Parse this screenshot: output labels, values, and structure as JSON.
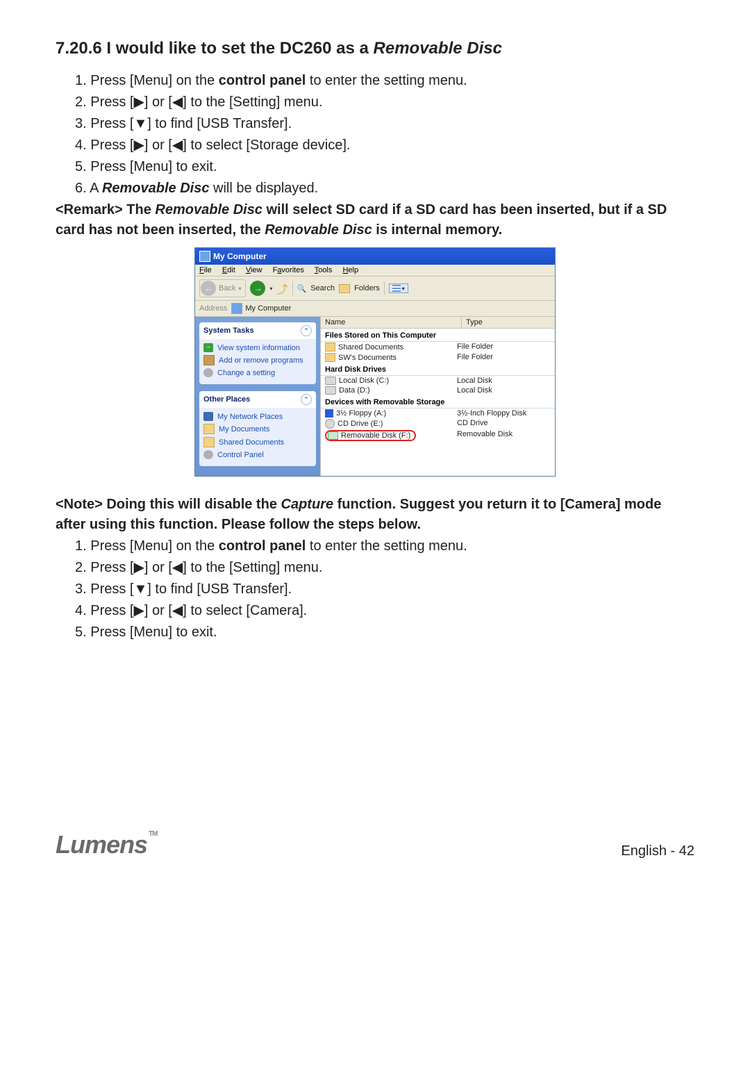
{
  "heading_num": "7.20.6",
  "heading_text_a": " I would like to set the DC260 as a ",
  "heading_text_italic": "Removable Disc",
  "steps1": {
    "s1a": "1. Press [Menu] on the ",
    "s1b": "control panel",
    "s1c": " to enter the setting menu.",
    "s2": "2. Press [▶] or [◀] to the [Setting] menu.",
    "s3": "3. Press [▼] to find [USB Transfer].",
    "s4": "4. Press [▶] or [◀] to select [Storage device].",
    "s5": "5. Press [Menu] to exit.",
    "s6a": "6. A ",
    "s6b": "Removable Disc",
    "s6c": " will be displayed."
  },
  "remark": {
    "a": "<Remark> The ",
    "b": "Removable Disc",
    "c": " will select SD card if a SD card has been inserted, but if a SD card has not been inserted, the ",
    "d": "Removable Disc",
    "e": " is internal memory."
  },
  "note": {
    "a": "<Note> Doing this will disable the ",
    "b": "Capture",
    "c": " function. Suggest you return it to [Camera] mode after using this function. Please follow the steps below."
  },
  "steps2": {
    "s1a": "1. Press [Menu] on the ",
    "s1b": "control panel",
    "s1c": " to enter the setting menu.",
    "s2": "2. Press [▶] or [◀] to the [Setting] menu.",
    "s3": "3. Press [▼] to find [USB Transfer].",
    "s4": "4. Press [▶] or [◀] to select [Camera].",
    "s5": "5. Press [Menu] to exit."
  },
  "win": {
    "title": "My Computer",
    "menu": {
      "file": "File",
      "edit": "Edit",
      "view": "View",
      "fav": "Favorites",
      "tools": "Tools",
      "help": "Help"
    },
    "toolbar": {
      "back": "Back",
      "search": "Search",
      "folders": "Folders"
    },
    "address_label": "Address",
    "address_value": "My Computer",
    "sidebar": {
      "tasks_hdr": "System Tasks",
      "t1": "View system information",
      "t2": "Add or remove programs",
      "t3": "Change a setting",
      "other_hdr": "Other Places",
      "o1": "My Network Places",
      "o2": "My Documents",
      "o3": "Shared Documents",
      "o4": "Control Panel"
    },
    "cols": {
      "name": "Name",
      "type": "Type"
    },
    "groups": {
      "g1": "Files Stored on This Computer",
      "g2": "Hard Disk Drives",
      "g3": "Devices with Removable Storage"
    },
    "rows": {
      "r1n": "Shared Documents",
      "r1t": "File Folder",
      "r2n": "SW's Documents",
      "r2t": "File Folder",
      "r3n": "Local Disk (C:)",
      "r3t": "Local Disk",
      "r4n": "Data (D:)",
      "r4t": "Local Disk",
      "r5n": "3½ Floppy (A:)",
      "r5t": "3½-Inch Floppy Disk",
      "r6n": "CD Drive (E:)",
      "r6t": "CD Drive",
      "r7n": "Removable Disk (F:)",
      "r7t": "Removable Disk"
    }
  },
  "footer": {
    "brand": "Lumens",
    "tm": "TM",
    "page": "English  -  42"
  }
}
